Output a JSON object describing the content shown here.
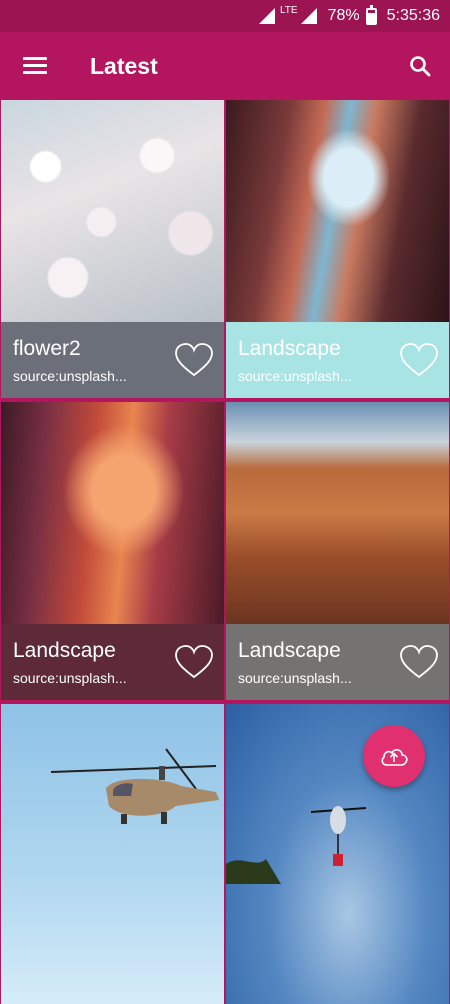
{
  "status_bar": {
    "network": "LTE",
    "battery": "78%",
    "time": "5:35:36"
  },
  "app_bar": {
    "title": "Latest",
    "menu_icon": "hamburger-menu-icon",
    "search_icon": "search-icon"
  },
  "cards": [
    {
      "name": "flower2",
      "source": "source:unsplash...",
      "caption_color": "#6b6f7a"
    },
    {
      "name": "Landscape",
      "source": "source:unsplash...",
      "caption_color": "#a9e4e4"
    },
    {
      "name": "Landscape",
      "source": "source:unsplash...",
      "caption_color": "#5e2a37"
    },
    {
      "name": "Landscape",
      "source": "source:unsplash...",
      "caption_color": "#757272"
    },
    {
      "name": "",
      "source": "",
      "caption_color": ""
    },
    {
      "name": "",
      "source": "",
      "caption_color": ""
    }
  ],
  "fab": {
    "icon": "cloud-upload-icon"
  },
  "colors": {
    "primary": "#b3165f",
    "status_bar": "#9c1451",
    "accent": "#e0306f"
  }
}
